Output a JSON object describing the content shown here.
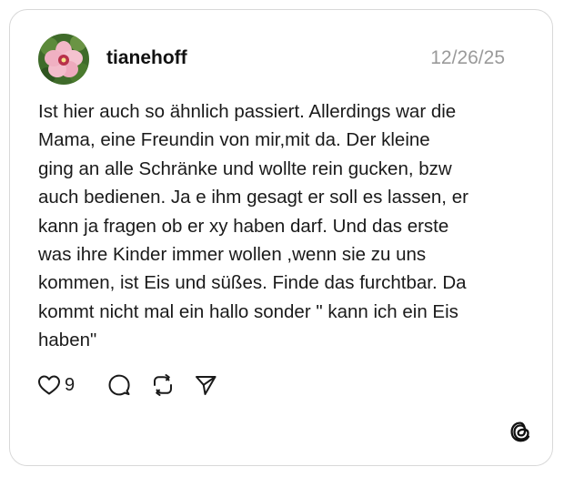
{
  "post": {
    "username": "tianehoff",
    "timestamp": "12/26/25",
    "body_lines": [
      "Ist hier auch so ähnlich passiert. Allerdings war die",
      "Mama, eine Freundin von mir,mit da. Der kleine",
      "ging an alle Schränke und wollte rein gucken, bzw",
      "auch bedienen. Ja e ihm gesagt er soll es lassen, er",
      "kann ja fragen ob er xy haben darf. Und das erste",
      "was ihre Kinder immer wollen ,wenn sie zu uns",
      "kommen, ist Eis und süßes. Finde das furchtbar. Da",
      "kommt nicht mal ein hallo sonder \" kann ich ein Eis",
      "haben\""
    ]
  },
  "actions": {
    "like_count": "9",
    "icons": [
      "heart-icon",
      "comment-icon",
      "repost-icon",
      "share-icon"
    ]
  },
  "brand": {
    "logo": "threads-logo-icon"
  },
  "colors": {
    "text": "#1a1a1a",
    "timestamp": "#9a9a9a",
    "border": "#d8d8d8",
    "background": "#ffffff"
  }
}
